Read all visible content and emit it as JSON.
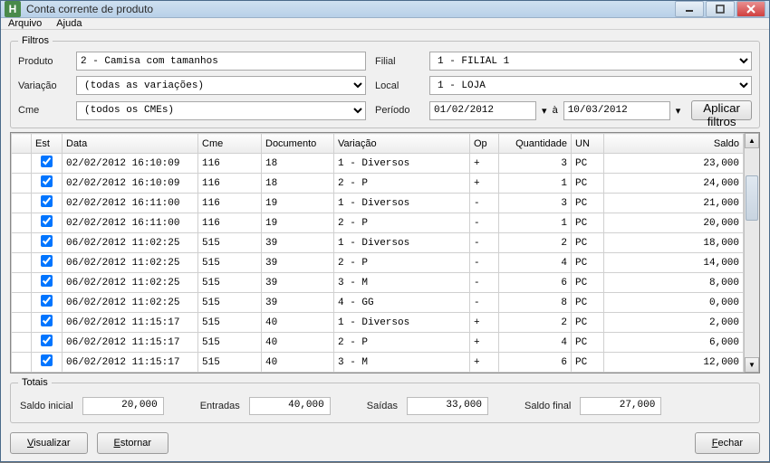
{
  "window": {
    "title": "Conta corrente de produto",
    "app_icon_letter": "H"
  },
  "menu": {
    "arquivo": "Arquivo",
    "ajuda": "Ajuda"
  },
  "filters": {
    "legend": "Filtros",
    "produto_label": "Produto",
    "produto_value": "2 - Camisa com tamanhos",
    "variacao_label": "Variação",
    "variacao_value": "(todas as variações)",
    "cme_label": "Cme",
    "cme_value": "(todos os CMEs)",
    "filial_label": "Filial",
    "filial_value": "1 - FILIAL 1",
    "local_label": "Local",
    "local_value": "1 - LOJA",
    "periodo_label": "Período",
    "periodo_from": "01/02/2012",
    "periodo_to": "10/03/2012",
    "periodo_sep": "à",
    "aplicar": "Aplicar filtros"
  },
  "columns": {
    "est": "Est",
    "data": "Data",
    "cme": "Cme",
    "documento": "Documento",
    "variacao": "Variação",
    "op": "Op",
    "quantidade": "Quantidade",
    "un": "UN",
    "saldo": "Saldo"
  },
  "rows": [
    {
      "est": true,
      "data": "02/02/2012 16:10:09",
      "cme": "116",
      "doc": "18",
      "var": "1 - Diversos",
      "op": "+",
      "qtd": "3",
      "un": "PC",
      "saldo": "23,000"
    },
    {
      "est": true,
      "data": "02/02/2012 16:10:09",
      "cme": "116",
      "doc": "18",
      "var": "2 - P",
      "op": "+",
      "qtd": "1",
      "un": "PC",
      "saldo": "24,000"
    },
    {
      "est": true,
      "data": "02/02/2012 16:11:00",
      "cme": "116",
      "doc": "19",
      "var": "1 - Diversos",
      "op": "-",
      "qtd": "3",
      "un": "PC",
      "saldo": "21,000"
    },
    {
      "est": true,
      "data": "02/02/2012 16:11:00",
      "cme": "116",
      "doc": "19",
      "var": "2 - P",
      "op": "-",
      "qtd": "1",
      "un": "PC",
      "saldo": "20,000"
    },
    {
      "est": true,
      "data": "06/02/2012 11:02:25",
      "cme": "515",
      "doc": "39",
      "var": "1 - Diversos",
      "op": "-",
      "qtd": "2",
      "un": "PC",
      "saldo": "18,000"
    },
    {
      "est": true,
      "data": "06/02/2012 11:02:25",
      "cme": "515",
      "doc": "39",
      "var": "2 - P",
      "op": "-",
      "qtd": "4",
      "un": "PC",
      "saldo": "14,000"
    },
    {
      "est": true,
      "data": "06/02/2012 11:02:25",
      "cme": "515",
      "doc": "39",
      "var": "3 - M",
      "op": "-",
      "qtd": "6",
      "un": "PC",
      "saldo": "8,000"
    },
    {
      "est": true,
      "data": "06/02/2012 11:02:25",
      "cme": "515",
      "doc": "39",
      "var": "4 - GG",
      "op": "-",
      "qtd": "8",
      "un": "PC",
      "saldo": "0,000"
    },
    {
      "est": true,
      "data": "06/02/2012 11:15:17",
      "cme": "515",
      "doc": "40",
      "var": "1 - Diversos",
      "op": "+",
      "qtd": "2",
      "un": "PC",
      "saldo": "2,000"
    },
    {
      "est": true,
      "data": "06/02/2012 11:15:17",
      "cme": "515",
      "doc": "40",
      "var": "2 - P",
      "op": "+",
      "qtd": "4",
      "un": "PC",
      "saldo": "6,000"
    },
    {
      "est": true,
      "data": "06/02/2012 11:15:17",
      "cme": "515",
      "doc": "40",
      "var": "3 - M",
      "op": "+",
      "qtd": "6",
      "un": "PC",
      "saldo": "12,000"
    }
  ],
  "totals": {
    "legend": "Totais",
    "saldo_inicial_label": "Saldo inicial",
    "saldo_inicial": "20,000",
    "entradas_label": "Entradas",
    "entradas": "40,000",
    "saidas_label": "Saídas",
    "saidas": "33,000",
    "saldo_final_label": "Saldo final",
    "saldo_final": "27,000"
  },
  "buttons": {
    "visualizar": "Visualizar",
    "estornar": "Estornar",
    "fechar": "Fechar"
  }
}
